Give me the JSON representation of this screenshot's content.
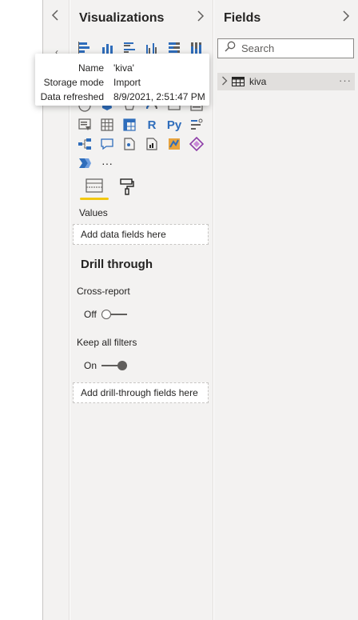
{
  "filters_pane": {
    "collapse_glyph": "‹"
  },
  "visualizations": {
    "title": "Visualizations",
    "icons": [
      [
        "stacked-bar-chart-icon",
        "stacked-column-chart-icon",
        "clustered-bar-chart-icon",
        "clustered-column-chart-icon",
        "100-stacked-bar-chart-icon",
        "100-stacked-column-chart-icon"
      ],
      [
        "line-chart-icon",
        "area-chart-icon",
        "stacked-area-chart-icon",
        "line-clustered-column-icon",
        "line-stacked-column-icon",
        "ribbon-chart-icon"
      ],
      [
        "waterfall-chart-icon",
        "funnel-chart-icon",
        "scatter-chart-icon",
        "pie-chart-icon",
        "donut-chart-icon",
        "treemap-icon"
      ],
      [
        "map-icon",
        "filled-map-icon",
        "shape-map-icon",
        "gauge-icon",
        "card-icon",
        "multi-row-card-icon"
      ],
      [
        "slicer-icon",
        "table-icon",
        "matrix-icon",
        "r-script-visual-icon",
        "python-visual-icon",
        "key-influencers-icon"
      ],
      [
        "decomposition-tree-icon",
        "qa-visual-icon",
        "smart-narrative-icon",
        "paginated-report-icon",
        "arcgis-map-icon",
        "power-apps-icon"
      ],
      [
        "power-automate-icon",
        "more-visuals-icon"
      ]
    ],
    "r_label": "R",
    "py_label": "Py",
    "more_label": "···",
    "tabs": {
      "fields_tab": "fields-tab-icon",
      "format_tab": "format-paint-roller-icon"
    },
    "values_label": "Values",
    "values_well": "Add data fields here",
    "drill_through": {
      "title": "Drill through",
      "cross_report_label": "Cross-report",
      "cross_report_state": "Off",
      "keep_filters_label": "Keep all filters",
      "keep_filters_state": "On",
      "drill_well": "Add drill-through fields here"
    }
  },
  "fields": {
    "title": "Fields",
    "search_placeholder": "Search",
    "tables": [
      {
        "name": "kiva",
        "more": "···"
      }
    ]
  },
  "tooltip": {
    "rows": [
      {
        "key": "Name",
        "value": "'kiva'"
      },
      {
        "key": "Storage mode",
        "value": "Import"
      },
      {
        "key": "Data refreshed",
        "value": "8/9/2021, 2:51:47 PM"
      }
    ]
  },
  "colors": {
    "accent_underline": "#f2c811",
    "icon_blue": "#2f6dbb",
    "pane_bg": "#f3f2f1"
  }
}
